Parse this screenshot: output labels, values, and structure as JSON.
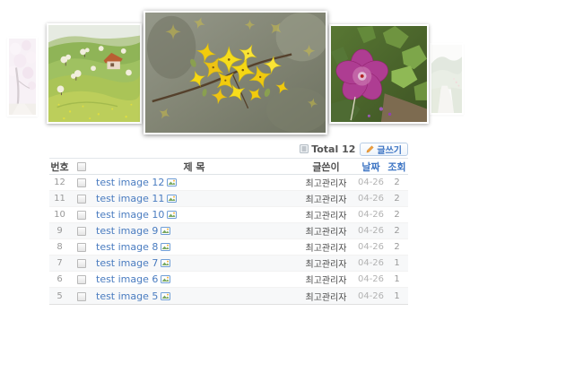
{
  "page": {
    "background": "#ffffff"
  },
  "carousel": {
    "images": [
      {
        "name": "pink-blossom-park",
        "desc": "faded photo of pale pink cherry blossoms over a park path"
      },
      {
        "name": "green-hills",
        "desc": "green rolling hills with white blossoming trees and a small farmhouse"
      },
      {
        "name": "yellow-forsythia",
        "desc": "focused photo of yellow forsythia flowers on a branch"
      },
      {
        "name": "purple-geranium",
        "desc": "magenta geranium flower among green leaves"
      },
      {
        "name": "garden-path",
        "desc": "faded photo of a garden path with trees"
      }
    ]
  },
  "toolbar": {
    "total_label": "Total 12",
    "write_label": "글쓰기"
  },
  "table": {
    "columns": {
      "no": "번호",
      "title": "제 목",
      "author": "글쓴이",
      "date": "날짜",
      "views": "조회"
    },
    "rows": [
      {
        "no": "12",
        "title": "test image 12",
        "author": "최고관리자",
        "date": "04-26",
        "views": "2"
      },
      {
        "no": "11",
        "title": "test image 11",
        "author": "최고관리자",
        "date": "04-26",
        "views": "2"
      },
      {
        "no": "10",
        "title": "test image 10",
        "author": "최고관리자",
        "date": "04-26",
        "views": "2"
      },
      {
        "no": "9",
        "title": "test image 9",
        "author": "최고관리자",
        "date": "04-26",
        "views": "2"
      },
      {
        "no": "8",
        "title": "test image 8",
        "author": "최고관리자",
        "date": "04-26",
        "views": "2"
      },
      {
        "no": "7",
        "title": "test image 7",
        "author": "최고관리자",
        "date": "04-26",
        "views": "1"
      },
      {
        "no": "6",
        "title": "test image 6",
        "author": "최고관리자",
        "date": "04-26",
        "views": "1"
      },
      {
        "no": "5",
        "title": "test image 5",
        "author": "최고관리자",
        "date": "04-26",
        "views": "1"
      }
    ]
  },
  "colors": {
    "accent_blue": "#3f76c4",
    "title_link": "#4a7cc0",
    "alt_row": "#f7f8f9",
    "muted_text": "#999999",
    "date_text": "#b3b3b3"
  }
}
